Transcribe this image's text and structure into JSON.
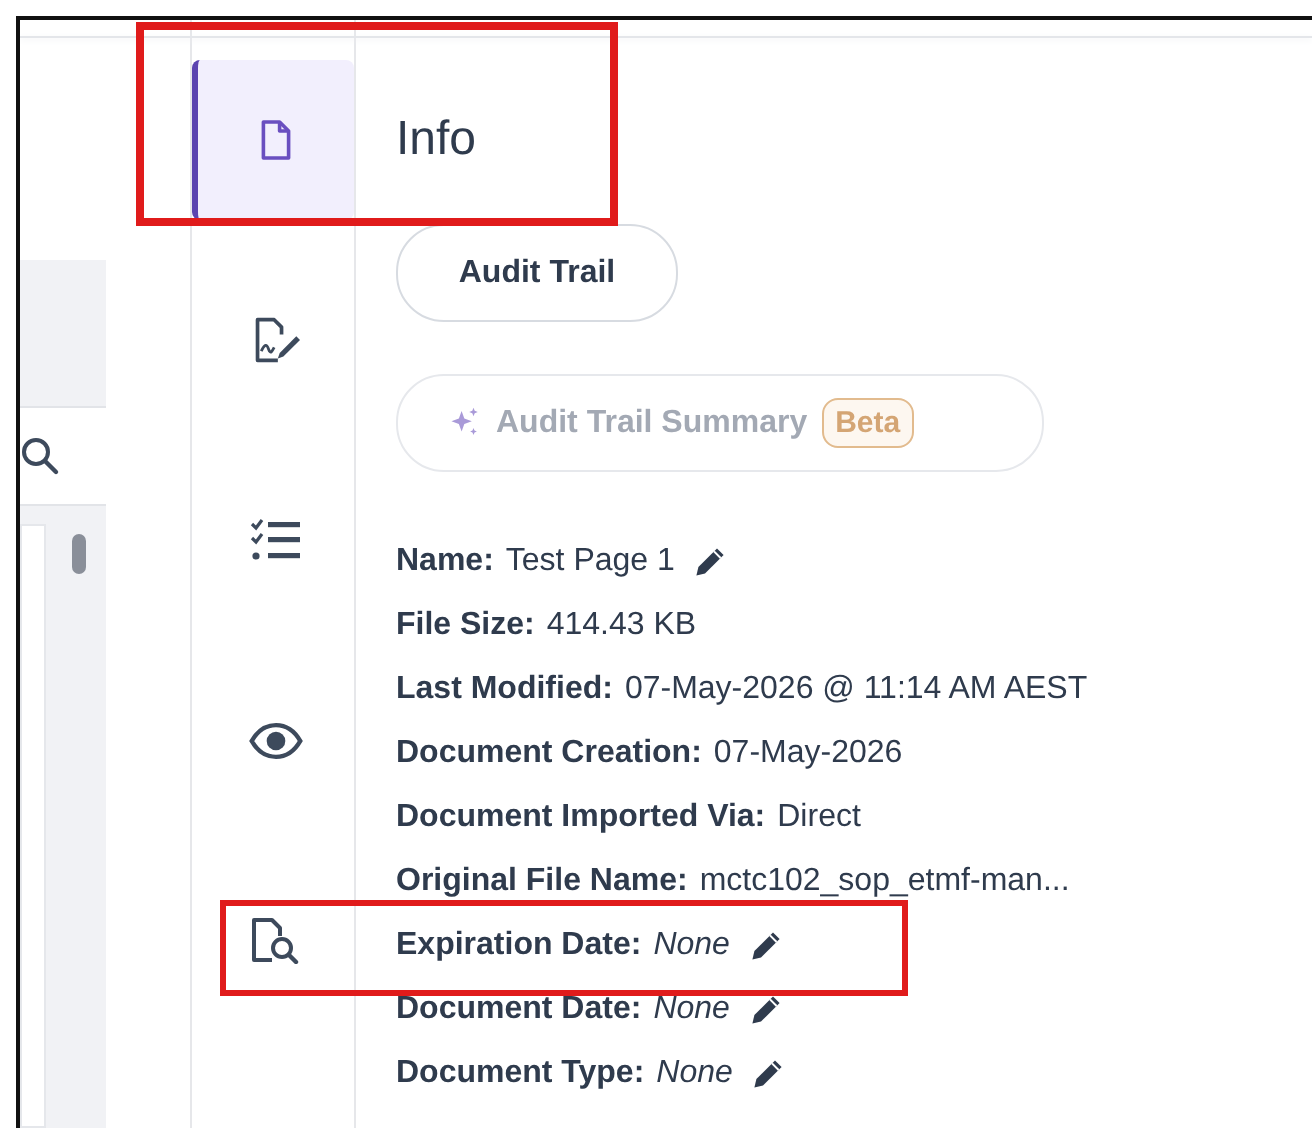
{
  "rail": [
    {
      "selected": true
    },
    {
      "selected": false
    },
    {
      "selected": false
    },
    {
      "selected": false
    },
    {
      "selected": false
    }
  ],
  "panel": {
    "title": "Info",
    "audit_button": "Audit Trail",
    "summary_button": {
      "label": "Audit Trail Summary",
      "badge": "Beta",
      "disabled": true
    },
    "fields": [
      {
        "label": "Name:",
        "value": "Test Page 1",
        "kind": "text",
        "editable": true
      },
      {
        "label": "File Size:",
        "value": "414.43 KB",
        "kind": "text",
        "editable": false
      },
      {
        "label": "Last Modified:",
        "value": "07-May-2026 @ 11:14 AM AEST",
        "kind": "text",
        "editable": false
      },
      {
        "label": "Document Creation:",
        "value": "07-May-2026",
        "kind": "text",
        "editable": false
      },
      {
        "label": "Document Imported Via:",
        "value": "Direct",
        "kind": "text",
        "editable": false
      },
      {
        "label": "Original File Name:",
        "value": "mctc102_sop_etmf-man...",
        "kind": "text",
        "editable": false
      },
      {
        "label": "Expiration Date:",
        "value": "None",
        "kind": "unset",
        "editable": true
      },
      {
        "label": "Document Date:",
        "value": "None",
        "kind": "unset",
        "editable": true
      },
      {
        "label": "Document Type:",
        "value": "None",
        "kind": "unset",
        "editable": true
      }
    ]
  }
}
